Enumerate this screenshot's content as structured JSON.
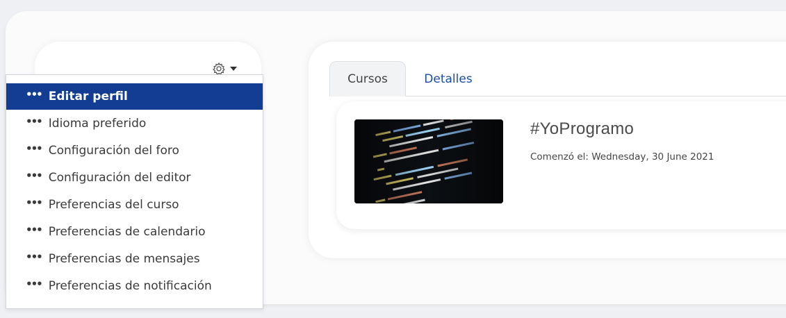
{
  "dropdown": {
    "items": [
      {
        "label": "Editar perfil",
        "active": true
      },
      {
        "label": "Idioma preferido",
        "active": false
      },
      {
        "label": "Configuración del foro",
        "active": false
      },
      {
        "label": "Configuración del editor",
        "active": false
      },
      {
        "label": "Preferencias del curso",
        "active": false
      },
      {
        "label": "Preferencias de calendario",
        "active": false
      },
      {
        "label": "Preferencias de mensajes",
        "active": false
      },
      {
        "label": "Preferencias de notificación",
        "active": false
      }
    ],
    "bullet": "•••",
    "toggle_icon": "gear-icon",
    "caret_icon": "caret-down-icon"
  },
  "tabs": [
    {
      "label": "Cursos",
      "active": true
    },
    {
      "label": "Detalles",
      "active": false
    }
  ],
  "course": {
    "title": "#YoProgramo",
    "date": "Comenzó el: Wednesday, 30 June 2021"
  },
  "colors": {
    "active_item_bg": "#123d93",
    "link_blue": "#1b4ea3"
  }
}
